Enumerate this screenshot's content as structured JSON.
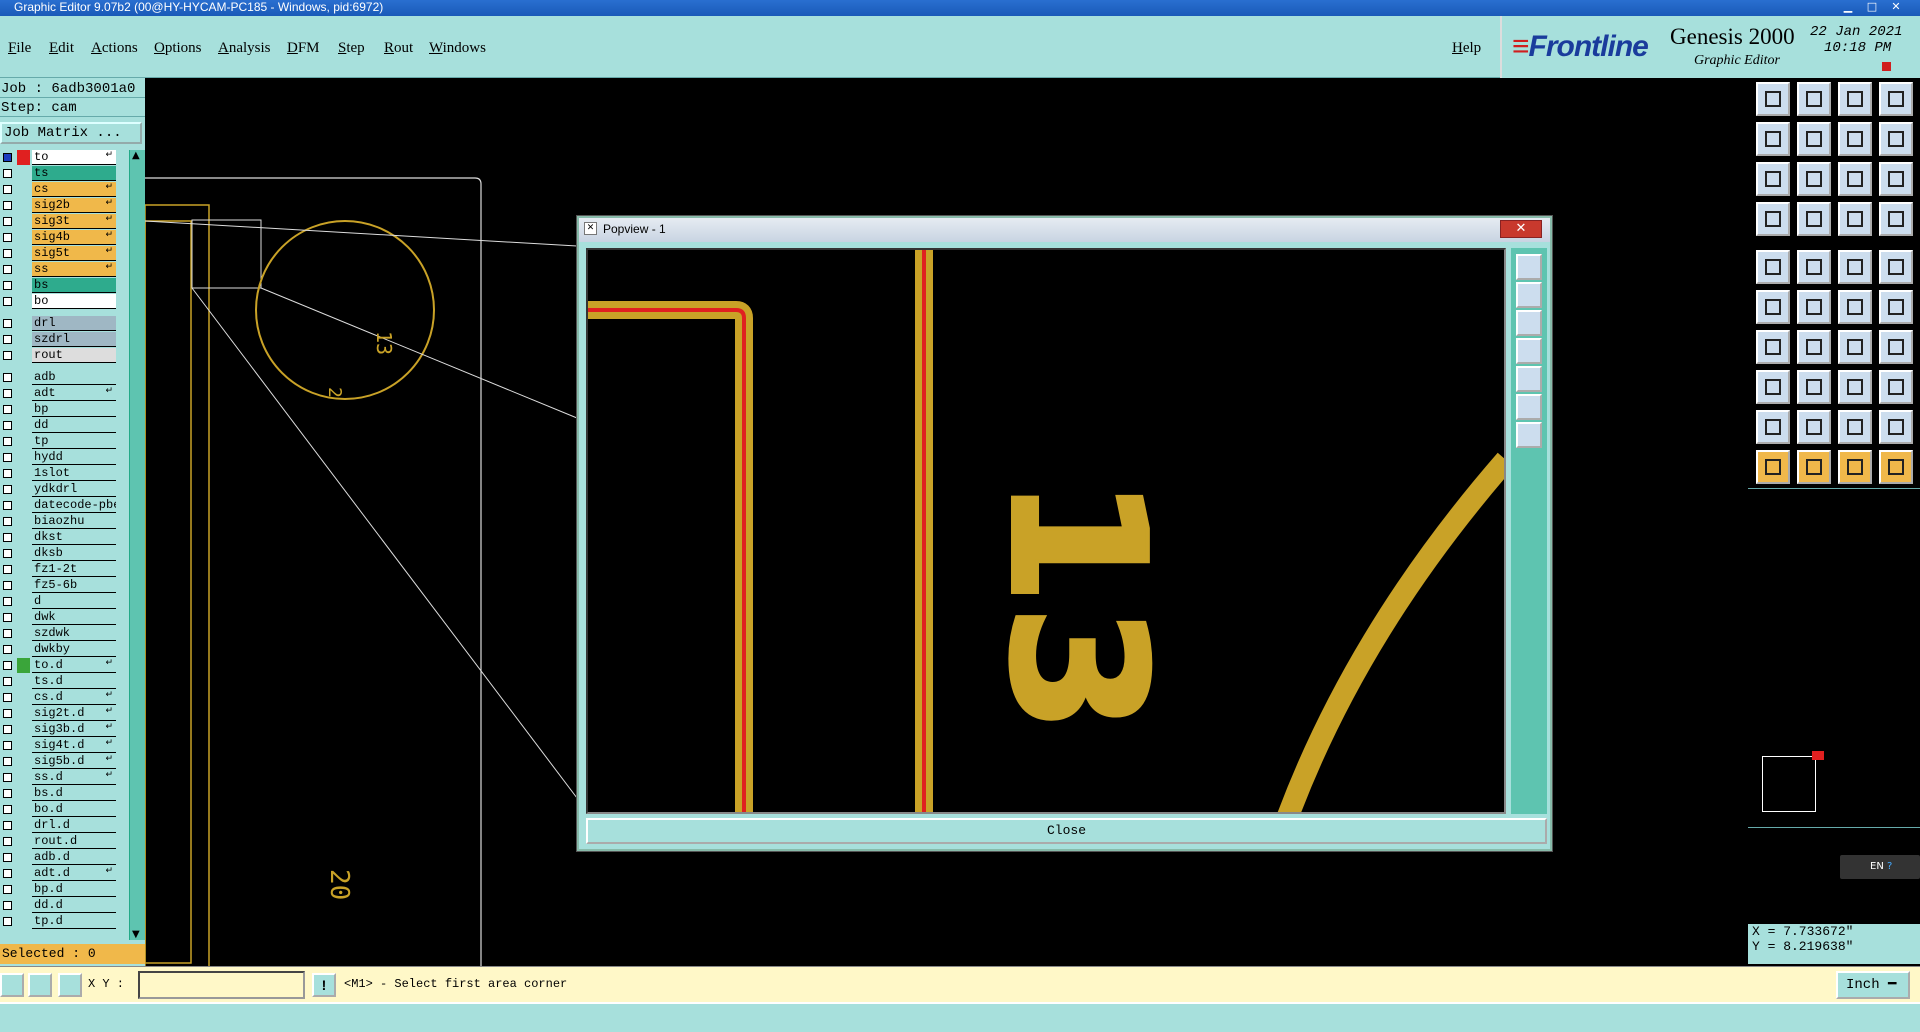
{
  "window": {
    "title": "Graphic Editor 9.07b2 (00@HY-HYCAM-PC185 - Windows, pid:6972)"
  },
  "menu": {
    "items": [
      "File",
      "Edit",
      "Actions",
      "Options",
      "Analysis",
      "DFM",
      "Step",
      "Rout",
      "Windows"
    ],
    "help": "Help"
  },
  "brand": {
    "logo": "Frontline",
    "product": "Genesis 2000",
    "subtitle": "Graphic Editor",
    "date": "22 Jan 2021",
    "time": "10:18 PM"
  },
  "job": {
    "job_text": "Job : 6adb3001a0",
    "step_text": "Step: cam",
    "matrix_button": "Job Matrix ..."
  },
  "layers": [
    {
      "name": "to",
      "color": "#ffffff",
      "flag": "↵"
    },
    {
      "name": "ts",
      "color": "#2eab8d"
    },
    {
      "name": "cs",
      "color": "#f0b84a",
      "flag": "↵"
    },
    {
      "name": "sig2b",
      "color": "#f0b84a",
      "flag": "↵"
    },
    {
      "name": "sig3t",
      "color": "#f0b84a",
      "flag": "↵"
    },
    {
      "name": "sig4b",
      "color": "#f0b84a",
      "flag": "↵"
    },
    {
      "name": "sig5t",
      "color": "#f0b84a",
      "flag": "↵"
    },
    {
      "name": "ss",
      "color": "#f0b84a",
      "flag": "↵"
    },
    {
      "name": "bs",
      "color": "#2eab8d"
    },
    {
      "name": "bo",
      "color": "#ffffff"
    },
    {
      "name": "drl",
      "color": "#9fb7c4"
    },
    {
      "name": "szdrl",
      "color": "#9fb7c4"
    },
    {
      "name": "rout",
      "color": "#dddddd"
    },
    {
      "name": "adb",
      "color": "#a7e0dc"
    },
    {
      "name": "adt",
      "color": "#a7e0dc",
      "flag": "↵"
    },
    {
      "name": "bp",
      "color": "#a7e0dc"
    },
    {
      "name": "dd",
      "color": "#a7e0dc"
    },
    {
      "name": "tp",
      "color": "#a7e0dc"
    },
    {
      "name": "hydd",
      "color": "#a7e0dc"
    },
    {
      "name": "1slot",
      "color": "#a7e0dc"
    },
    {
      "name": "ydkdrl",
      "color": "#a7e0dc"
    },
    {
      "name": "datecode-pbe",
      "color": "#a7e0dc"
    },
    {
      "name": "biaozhu",
      "color": "#a7e0dc"
    },
    {
      "name": "dkst",
      "color": "#a7e0dc"
    },
    {
      "name": "dksb",
      "color": "#a7e0dc"
    },
    {
      "name": "fz1-2t",
      "color": "#a7e0dc"
    },
    {
      "name": "fz5-6b",
      "color": "#a7e0dc"
    },
    {
      "name": "d",
      "color": "#a7e0dc"
    },
    {
      "name": "dwk",
      "color": "#a7e0dc"
    },
    {
      "name": "szdwk",
      "color": "#a7e0dc"
    },
    {
      "name": "dwkby",
      "color": "#a7e0dc"
    },
    {
      "name": "to.d",
      "color": "#a7e0dc",
      "flag": "↵"
    },
    {
      "name": "ts.d",
      "color": "#a7e0dc"
    },
    {
      "name": "cs.d",
      "color": "#a7e0dc",
      "flag": "↵"
    },
    {
      "name": "sig2t.d",
      "color": "#a7e0dc",
      "flag": "↵"
    },
    {
      "name": "sig3b.d",
      "color": "#a7e0dc",
      "flag": "↵"
    },
    {
      "name": "sig4t.d",
      "color": "#a7e0dc",
      "flag": "↵"
    },
    {
      "name": "sig5b.d",
      "color": "#a7e0dc",
      "flag": "↵"
    },
    {
      "name": "ss.d",
      "color": "#a7e0dc",
      "flag": "↵"
    },
    {
      "name": "bs.d",
      "color": "#a7e0dc"
    },
    {
      "name": "bo.d",
      "color": "#a7e0dc"
    },
    {
      "name": "drl.d",
      "color": "#a7e0dc"
    },
    {
      "name": "rout.d",
      "color": "#a7e0dc"
    },
    {
      "name": "adb.d",
      "color": "#a7e0dc"
    },
    {
      "name": "adt.d",
      "color": "#a7e0dc",
      "flag": "↵"
    },
    {
      "name": "bp.d",
      "color": "#a7e0dc"
    },
    {
      "name": "dd.d",
      "color": "#a7e0dc"
    },
    {
      "name": "tp.d",
      "color": "#a7e0dc"
    }
  ],
  "selected": "Selected : 0",
  "canvas": {
    "labels": [
      "13",
      "2",
      "20"
    ]
  },
  "popview": {
    "title": "Popview - 1",
    "close_x": "✕",
    "close_button": "Close",
    "labels": [
      "13"
    ]
  },
  "toolbar": {
    "tools": [
      "copy",
      "paste",
      "home",
      "layout",
      "in",
      "out",
      "split",
      "snap",
      "fit",
      "zoom",
      "scale",
      "help",
      "redraw",
      "grid",
      "route",
      "netlist",
      "circle",
      "line",
      "ruler",
      "pad",
      "connect",
      "cross",
      "move-pt",
      "arrow-pt",
      "angle",
      "slash",
      "arc",
      "flip",
      "snap-pt",
      "line-h",
      "measure",
      "cluster",
      "tri1",
      "tri2",
      "tri3",
      "tri4",
      "select",
      "select2",
      "select3",
      "select4"
    ]
  },
  "coords": {
    "x": "X = 7.733672\"",
    "y": "Y = 8.219638\""
  },
  "lang": {
    "code": "EN"
  },
  "bottom": {
    "xy_label": "X Y :",
    "xy_value": "",
    "warning": "!",
    "prompt": "<M1> - Select first area corner",
    "unit": "Inch ━"
  },
  "colors": {
    "panel": "#a7e0dc",
    "accent": "#f0b84a",
    "board": "#c9a227",
    "trace_red": "#e02020"
  }
}
